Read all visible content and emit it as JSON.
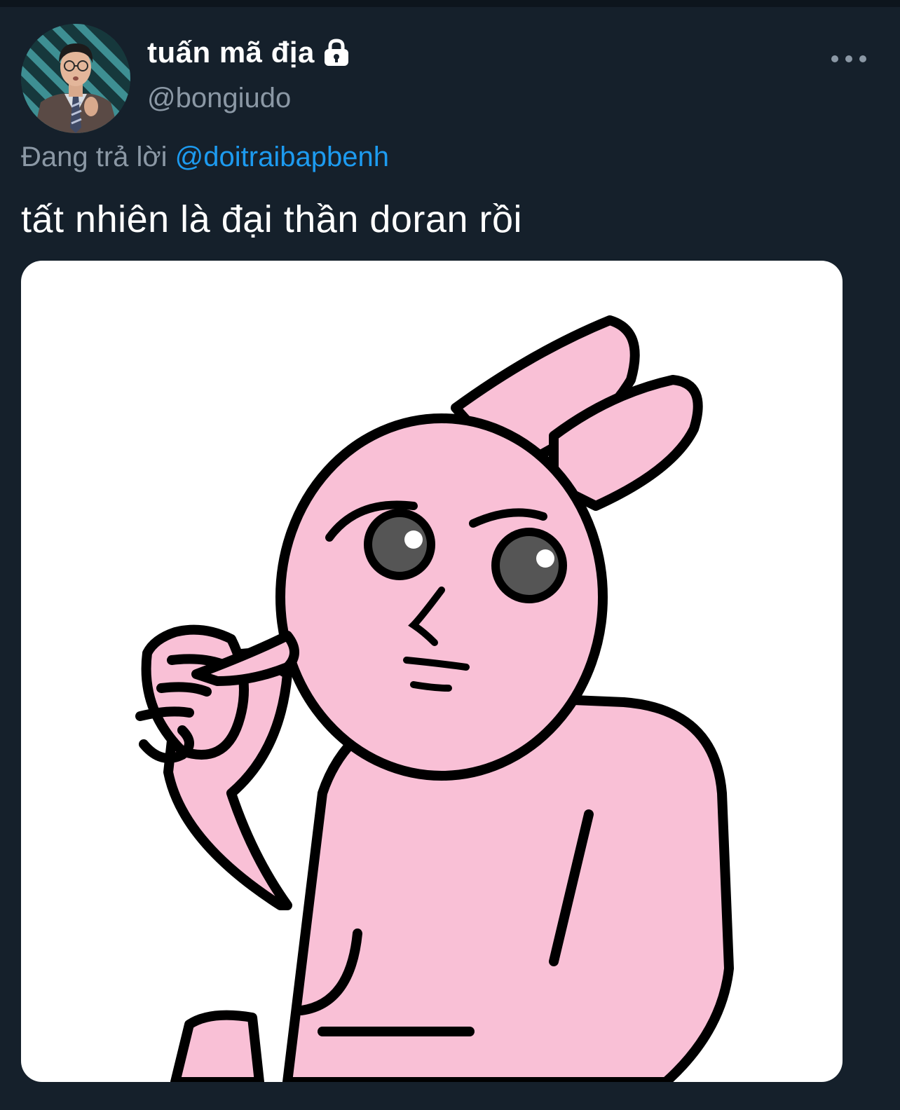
{
  "tweet": {
    "display_name": "tuấn mã địa",
    "handle": "@bongiudo",
    "reply_prefix": "Đang trả lời",
    "reply_to": "@doitraibapbenh",
    "text": "tất nhiên là đại thần doran rồi",
    "icons": {
      "lock": "lock-icon",
      "more": "more-dots-icon"
    }
  },
  "colors": {
    "background": "#15202b",
    "primary_text": "#ffffff",
    "secondary_text": "#8b98a5",
    "accent": "#1d9bf0",
    "sticker_pink": "#f9c0d6"
  }
}
